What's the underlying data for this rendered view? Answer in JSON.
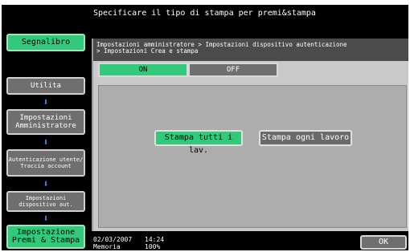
{
  "header": {
    "message": "Specificare il tipo di stampa per premi&stampa"
  },
  "sidebar": {
    "bookmark_label": "Segnalibro",
    "items": [
      {
        "label": "Utilita"
      },
      {
        "label": "Impostazioni Amministratore"
      },
      {
        "label": "Autenticazione utente/ Traccia account"
      },
      {
        "label": "Impostazioni dispositivo aut."
      },
      {
        "label": "Impostazione Premi & Stampa"
      }
    ],
    "arrow_icon": "down-arrow-icon"
  },
  "main": {
    "breadcrumb_line1": "Impostazioni amministratore > Impostazioni dispositivo autenticazione",
    "breadcrumb_line2": "> Impostazioni Crea e stampa",
    "on_label": "ON",
    "off_label": "OFF",
    "print_all_label": "Stampa tutti i lav.",
    "print_each_label": "Stampa ogni lavoro"
  },
  "status": {
    "date": "02/03/2007",
    "time": "14:24",
    "memory_label": "Memoria",
    "memory_value": "100%"
  },
  "ok_label": "OK",
  "colors": {
    "accent": "#33c87a",
    "background": "#000000",
    "panel": "#adadad",
    "arrow": "#4a8cf0"
  }
}
